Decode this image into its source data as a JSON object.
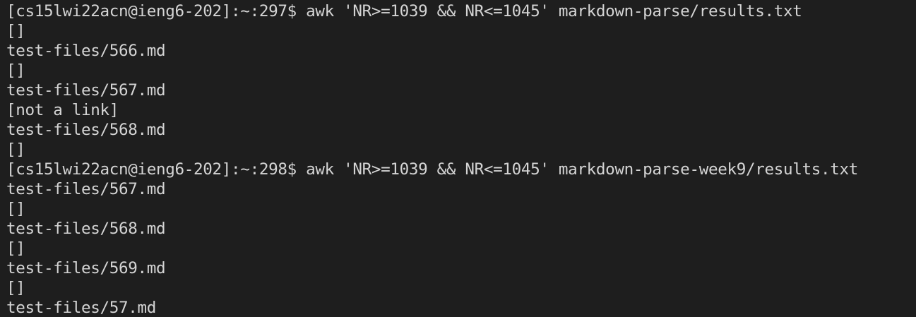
{
  "terminal": {
    "lines": [
      "[cs15lwi22acn@ieng6-202]:~:297$ awk 'NR>=1039 && NR<=1045' markdown-parse/results.txt",
      "[]",
      "test-files/566.md",
      "[]",
      "test-files/567.md",
      "[not a link]",
      "test-files/568.md",
      "[]",
      "[cs15lwi22acn@ieng6-202]:~:298$ awk 'NR>=1039 && NR<=1045' markdown-parse-week9/results.txt",
      "test-files/567.md",
      "[]",
      "test-files/568.md",
      "[]",
      "test-files/569.md",
      "[]",
      "test-files/57.md"
    ]
  },
  "colors": {
    "background": "#1e1e1e",
    "foreground": "#d4d4d4"
  }
}
